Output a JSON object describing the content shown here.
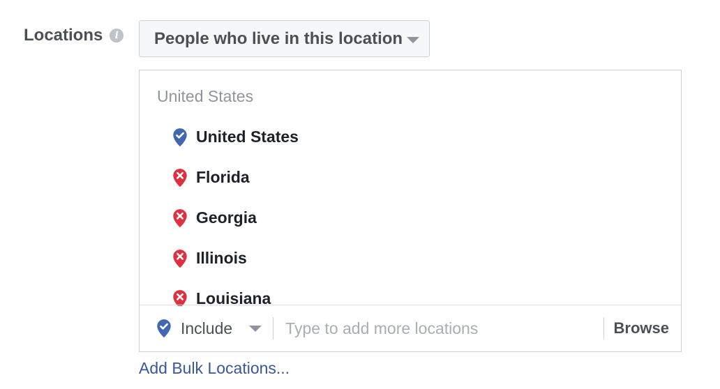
{
  "locations_field": {
    "label": "Locations",
    "info_glyph": "i",
    "info_icon": "info-icon",
    "targeting_dropdown": {
      "selected": "People who live in this location",
      "icon": "chevron-down-icon"
    },
    "group_header": "United States",
    "items": [
      {
        "name": "United States",
        "status": "included",
        "icon": "location-pin-check-icon"
      },
      {
        "name": "Florida",
        "status": "excluded",
        "icon": "location-pin-x-icon"
      },
      {
        "name": "Georgia",
        "status": "excluded",
        "icon": "location-pin-x-icon"
      },
      {
        "name": "Illinois",
        "status": "excluded",
        "icon": "location-pin-x-icon"
      },
      {
        "name": "Louisiana",
        "status": "excluded",
        "icon": "location-pin-x-icon"
      }
    ],
    "input_row": {
      "mode_label": "Include",
      "mode_icon": "location-pin-check-icon",
      "placeholder": "Type to add more locations",
      "browse_label": "Browse"
    },
    "bulk_link": "Add Bulk Locations..."
  },
  "colors": {
    "include_blue": "#4267b2",
    "exclude_red": "#e02f3e",
    "link_blue": "#365899",
    "label_gray": "#4b4f56",
    "muted_gray": "#90949c",
    "border_gray": "#ccd0d5"
  }
}
